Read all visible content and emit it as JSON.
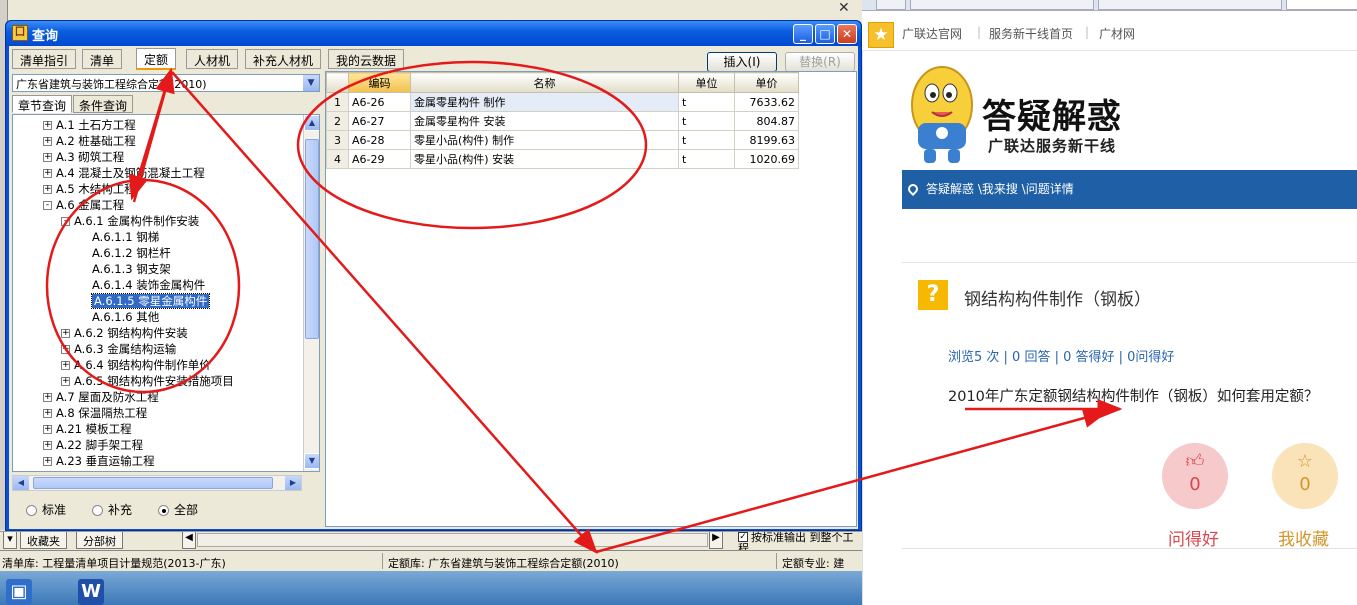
{
  "dialog": {
    "title": "查询",
    "tabs": [
      "清单指引",
      "清单",
      "定额",
      "人材机",
      "补充人材机",
      "我的云数据"
    ],
    "active_tab": "定额",
    "insert_label": "插入(I)",
    "replace_label": "替换(R)",
    "quota_library": "广东省建筑与装饰工程综合定额(2010)",
    "subtabs": [
      "章节查询",
      "条件查询"
    ],
    "tree": [
      {
        "label": "A.1 土石方工程",
        "level": 0,
        "expander": "+"
      },
      {
        "label": "A.2 桩基础工程",
        "level": 0,
        "expander": "+"
      },
      {
        "label": "A.3 砌筑工程",
        "level": 0,
        "expander": "+"
      },
      {
        "label": "A.4 混凝土及钢筋混凝土工程",
        "level": 0,
        "expander": "+"
      },
      {
        "label": "A.5 木结构工程",
        "level": 0,
        "expander": "+"
      },
      {
        "label": "A.6 金属工程",
        "level": 0,
        "expander": "-"
      },
      {
        "label": "A.6.1 金属构件制作安装",
        "level": 1,
        "expander": "-"
      },
      {
        "label": "A.6.1.1 钢梯",
        "level": 2,
        "expander": ""
      },
      {
        "label": "A.6.1.2 钢栏杆",
        "level": 2,
        "expander": ""
      },
      {
        "label": "A.6.1.3 钢支架",
        "level": 2,
        "expander": ""
      },
      {
        "label": "A.6.1.4 装饰金属构件",
        "level": 2,
        "expander": ""
      },
      {
        "label": "A.6.1.5 零星金属构件",
        "level": 2,
        "expander": "",
        "selected": true
      },
      {
        "label": "A.6.1.6 其他",
        "level": 2,
        "expander": ""
      },
      {
        "label": "A.6.2 钢结构构件安装",
        "level": 1,
        "expander": "+"
      },
      {
        "label": "A.6.3 金属结构运输",
        "level": 1,
        "expander": "+"
      },
      {
        "label": "A.6.4 钢结构构件制作单价",
        "level": 1,
        "expander": "+"
      },
      {
        "label": "A.6.5 钢结构构件安装措施项目",
        "level": 1,
        "expander": "+"
      },
      {
        "label": "A.7 屋面及防水工程",
        "level": 0,
        "expander": "+"
      },
      {
        "label": "A.8 保温隔热工程",
        "level": 0,
        "expander": "+"
      },
      {
        "label": "A.21 模板工程",
        "level": 0,
        "expander": "+"
      },
      {
        "label": "A.22 脚手架工程",
        "level": 0,
        "expander": "+"
      },
      {
        "label": "A.23 垂直运输工程",
        "level": 0,
        "expander": "+"
      }
    ],
    "radios": [
      {
        "label": "标准",
        "checked": false
      },
      {
        "label": "补充",
        "checked": false
      },
      {
        "label": "全部",
        "checked": true
      }
    ],
    "table": {
      "headers": [
        "编码",
        "名称",
        "单位",
        "单价"
      ],
      "rows": [
        {
          "num": "1",
          "code": "A6-26",
          "name": "金属零星构件 制作",
          "unit": "t",
          "price": "7633.62"
        },
        {
          "num": "2",
          "code": "A6-27",
          "name": "金属零星构件 安装",
          "unit": "t",
          "price": "804.87"
        },
        {
          "num": "3",
          "code": "A6-28",
          "name": "零星小品(构件) 制作",
          "unit": "t",
          "price": "8199.63"
        },
        {
          "num": "4",
          "code": "A6-29",
          "name": "零星小品(构件) 安装",
          "unit": "t",
          "price": "1020.69"
        }
      ]
    }
  },
  "background_app": {
    "bottom_tabs": [
      "收藏夹",
      "分部树"
    ],
    "check_label": "按标准输出 到整个工程",
    "status": {
      "list_lib": "清单库: 工程量清单项目计量规范(2013-广东)",
      "quota_lib": "定额库: 广东省建筑与装饰工程综合定额(2010)",
      "specialty": "定额专业: 建"
    }
  },
  "browser": {
    "bookmarks": [
      "广联达官网",
      "服务新干线首页",
      "广材网"
    ],
    "slogan": "答疑解惑",
    "subslogan": "广联达服务新干线",
    "breadcrumb": "答疑解惑 \\我来搜 \\问题详情",
    "question": {
      "badge": "?",
      "title": "钢结构构件制作（钢板）",
      "meta": "浏览5 次 | 0 回答 | 0 答得好 | 0问得好",
      "body": "2010年广东定额钢结构构件制作（钢板）如何套用定额？",
      "good_count": "0",
      "good_label": "问得好",
      "fav_count": "0",
      "fav_label": "我收藏"
    }
  },
  "colors": {
    "annotation_red": "#e41a1a",
    "brand_blue": "#1f5fa6",
    "question_yellow": "#f6b800",
    "good_pink": "#f6c9cb",
    "fav_beige": "#fbe3b9"
  }
}
